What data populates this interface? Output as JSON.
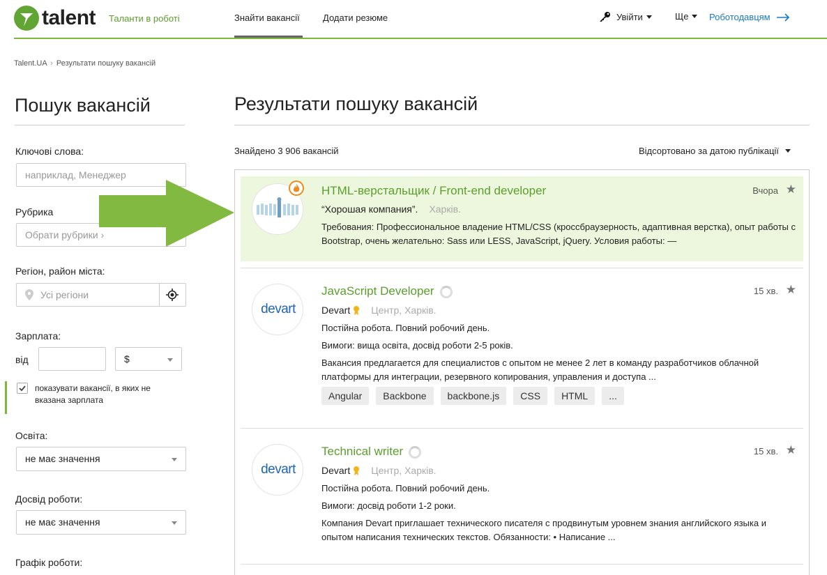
{
  "header": {
    "logo_text": "talent",
    "tagline": "Таланти в роботі",
    "nav": [
      "Знайти вакансії",
      "Додати резюме"
    ],
    "login_label": "Увійти",
    "more_label": "Ще",
    "employers_label": "Роботодавцям",
    "accent_color": "#7cb83a",
    "link_color": "#1a7ac0"
  },
  "breadcrumb": {
    "home": "Talent.UA",
    "separator": "›",
    "current": "Результати пошуку вакансій"
  },
  "sidebar": {
    "title": "Пошук вакансій",
    "keywords_label": "Ключові слова:",
    "keywords_placeholder": "наприклад, Менеджер",
    "category_label": "Рубрика",
    "category_placeholder": "Обрати рубрики ›",
    "region_label": "Регіон, район міста:",
    "region_placeholder": "Усі регіони",
    "salary_label": "Зарплата:",
    "salary_from": "від",
    "currency": "$",
    "show_no_salary": "показувати вакансії, в яких не вказана зарплата",
    "education_label": "Освіта:",
    "education_value": "не має значення",
    "experience_label": "Досвід роботи:",
    "experience_value": "не має значення",
    "schedule_label": "Графік роботи:"
  },
  "main": {
    "title": "Результати пошуку вакансій",
    "found": "Знайдено 3 906 вакансій",
    "sort": "Відсортовано за датою публікації"
  },
  "jobs": [
    {
      "title": "HTML-верстальщик / Front-end developer",
      "time": "Вчора",
      "company": "“Хорошая компания”.",
      "location": "Харків.",
      "lines": [
        "Требования: Профессиональное владение HTML/CSS (кроссбраузерность, адаптивная верстка), опыт работы с Bootstrap, очень желательно: Sass или LESS, JavaScript, jQuery. Условия работы: —"
      ]
    },
    {
      "title": "JavaScript Developer",
      "time": "15 хв.",
      "company": "Devart",
      "location": "Центр, Харків.",
      "logo": "devart",
      "lines": [
        "Постійна робота. Повний робочий день.",
        "Вимоги: вища освіта, досвід роботи 2-5 років.",
        "Вакансия предлагается для специалистов с опытом не менее 2 лет в команду разработчиков облачной платформы для интеграции, резервного копирования, управления и доступа ..."
      ],
      "tags": [
        "Angular",
        "Backbone",
        "backbone.js",
        "CSS",
        "HTML",
        "..."
      ]
    },
    {
      "title": "Technical writer",
      "time": "15 хв.",
      "company": "Devart",
      "location": "Центр, Харків.",
      "logo": "devart",
      "lines": [
        "Постійна робота. Повний робочий день.",
        "Вимоги: досвід роботи 1-2 роки.",
        "Компания Devart приглашает технического писателя с продвинутым уровнем знания английского языка и опытом написания технических текстов. Обязанности: • Написание ..."
      ]
    }
  ]
}
